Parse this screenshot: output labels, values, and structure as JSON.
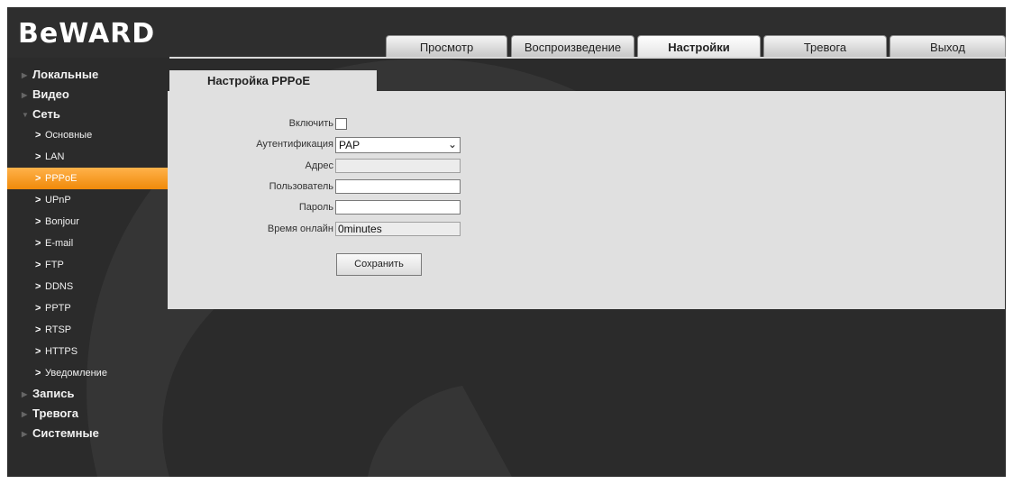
{
  "logo": "BeWARD",
  "tabs": [
    {
      "label": "Просмотр",
      "active": false
    },
    {
      "label": "Воспроизведение",
      "active": false
    },
    {
      "label": "Настройки",
      "active": true
    },
    {
      "label": "Тревога",
      "active": false
    },
    {
      "label": "Выход",
      "active": false
    }
  ],
  "sidebar": {
    "top": [
      {
        "label": "Локальные"
      },
      {
        "label": "Видео"
      },
      {
        "label": "Сеть"
      },
      {
        "label": "Запись"
      },
      {
        "label": "Тревога"
      },
      {
        "label": "Системные"
      }
    ],
    "network_items": [
      {
        "label": "Основные"
      },
      {
        "label": "LAN"
      },
      {
        "label": "PPPoE"
      },
      {
        "label": "UPnP"
      },
      {
        "label": "Bonjour"
      },
      {
        "label": "E-mail"
      },
      {
        "label": "FTP"
      },
      {
        "label": "DDNS"
      },
      {
        "label": "PPTP"
      },
      {
        "label": "RTSP"
      },
      {
        "label": "HTTPS"
      },
      {
        "label": "Уведомление"
      }
    ],
    "active_item": "PPPoE"
  },
  "page": {
    "tab_title": "Настройка PPPoE"
  },
  "form": {
    "enable_label": "Включить",
    "enable_checked": false,
    "auth_label": "Аутентификация",
    "auth_value": "PAP",
    "address_label": "Адрес",
    "address_value": "",
    "user_label": "Пользователь",
    "user_value": "",
    "password_label": "Пароль",
    "password_value": "",
    "online_label": "Время онлайн",
    "online_value": "0minutes",
    "save_label": "Сохранить"
  },
  "colors": {
    "accent": "#f39a1e",
    "background": "#2b2b2b",
    "panel": "#e0e0e0"
  },
  "icons": {
    "collapsed": "triangle-right-icon",
    "expanded": "triangle-down-icon",
    "subitem": "chevron-right-icon",
    "select": "chevron-down-icon"
  }
}
